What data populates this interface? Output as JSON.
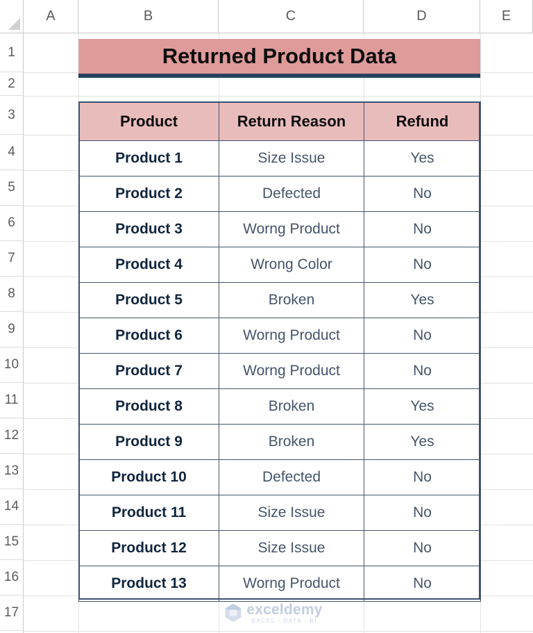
{
  "spreadsheet": {
    "column_headers": [
      "A",
      "B",
      "C",
      "D",
      "E"
    ],
    "row_numbers": [
      "1",
      "2",
      "3",
      "4",
      "5",
      "6",
      "7",
      "8",
      "9",
      "10",
      "11",
      "12",
      "13",
      "14",
      "15",
      "16",
      "17"
    ],
    "select_all_icon": "select-all-triangle"
  },
  "title": {
    "text": "Returned Product Data",
    "fill_color": "#DF9A9A",
    "underline_color": "#28415C",
    "text_color": "#0D0D0D"
  },
  "table": {
    "header_fill": "#E9BCBC",
    "border_color": "#44546A",
    "product_text_color": "#10253E",
    "body_text_color": "#44546A",
    "headers": [
      "Product",
      "Return Reason",
      "Refund"
    ],
    "rows": [
      {
        "product": "Product 1",
        "reason": "Size Issue",
        "refund": "Yes"
      },
      {
        "product": "Product 2",
        "reason": "Defected",
        "refund": "No"
      },
      {
        "product": "Product 3",
        "reason": "Worng Product",
        "refund": "No"
      },
      {
        "product": "Product 4",
        "reason": "Wrong Color",
        "refund": "No"
      },
      {
        "product": "Product 5",
        "reason": "Broken",
        "refund": "Yes"
      },
      {
        "product": "Product 6",
        "reason": "Worng Product",
        "refund": "No"
      },
      {
        "product": "Product 7",
        "reason": "Worng Product",
        "refund": "No"
      },
      {
        "product": "Product 8",
        "reason": "Broken",
        "refund": "Yes"
      },
      {
        "product": "Product 9",
        "reason": "Broken",
        "refund": "Yes"
      },
      {
        "product": "Product 10",
        "reason": "Defected",
        "refund": "No"
      },
      {
        "product": "Product 11",
        "reason": "Size Issue",
        "refund": "No"
      },
      {
        "product": "Product 12",
        "reason": "Size Issue",
        "refund": "No"
      },
      {
        "product": "Product 13",
        "reason": "Worng Product",
        "refund": "No"
      }
    ]
  },
  "watermark": {
    "name": "exceldemy",
    "tagline": "EXCEL · DATA · BI",
    "logo_icon": "exceldemy-cube-logo"
  }
}
